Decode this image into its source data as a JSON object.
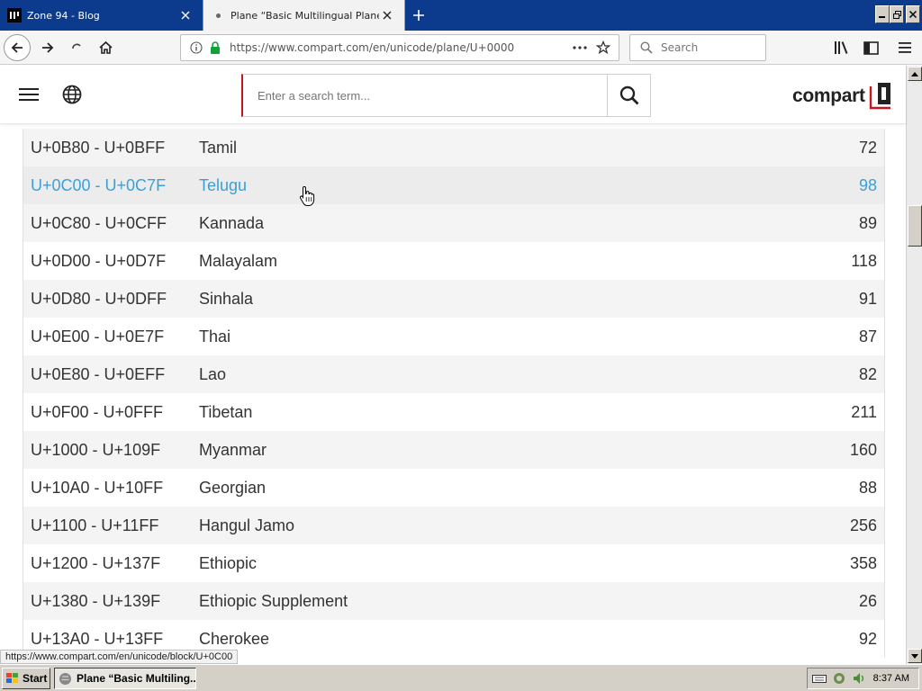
{
  "browser": {
    "tabs": [
      {
        "title": "Zone 94 - Blog",
        "active": false
      },
      {
        "title": "Plane “Basic Multilingual Plane”",
        "active": true
      }
    ],
    "url": "https://www.compart.com/en/unicode/plane/U+0000",
    "search_placeholder": "Search"
  },
  "site": {
    "search_placeholder": "Enter a search term...",
    "logo_text": "compart",
    "brand_color": "#c4161c",
    "link_color": "#3aa0d8"
  },
  "blocks": [
    {
      "range": "U+0B80 - U+0BFF",
      "name": "Tamil",
      "count": "72"
    },
    {
      "range": "U+0C00 - U+0C7F",
      "name": "Telugu",
      "count": "98"
    },
    {
      "range": "U+0C80 - U+0CFF",
      "name": "Kannada",
      "count": "89"
    },
    {
      "range": "U+0D00 - U+0D7F",
      "name": "Malayalam",
      "count": "118"
    },
    {
      "range": "U+0D80 - U+0DFF",
      "name": "Sinhala",
      "count": "91"
    },
    {
      "range": "U+0E00 - U+0E7F",
      "name": "Thai",
      "count": "87"
    },
    {
      "range": "U+0E80 - U+0EFF",
      "name": "Lao",
      "count": "82"
    },
    {
      "range": "U+0F00 - U+0FFF",
      "name": "Tibetan",
      "count": "211"
    },
    {
      "range": "U+1000 - U+109F",
      "name": "Myanmar",
      "count": "160"
    },
    {
      "range": "U+10A0 - U+10FF",
      "name": "Georgian",
      "count": "88"
    },
    {
      "range": "U+1100 - U+11FF",
      "name": "Hangul Jamo",
      "count": "256"
    },
    {
      "range": "U+1200 - U+137F",
      "name": "Ethiopic",
      "count": "358"
    },
    {
      "range": "U+1380 - U+139F",
      "name": "Ethiopic Supplement",
      "count": "26"
    },
    {
      "range": "U+13A0 - U+13FF",
      "name": "Cherokee",
      "count": "92"
    }
  ],
  "hovered_block": "Telugu",
  "status_link": "https://www.compart.com/en/unicode/block/U+0C00",
  "taskbar": {
    "start_label": "Start",
    "task_label": "Plane “Basic Multiling...",
    "clock": "8:37 AM"
  }
}
